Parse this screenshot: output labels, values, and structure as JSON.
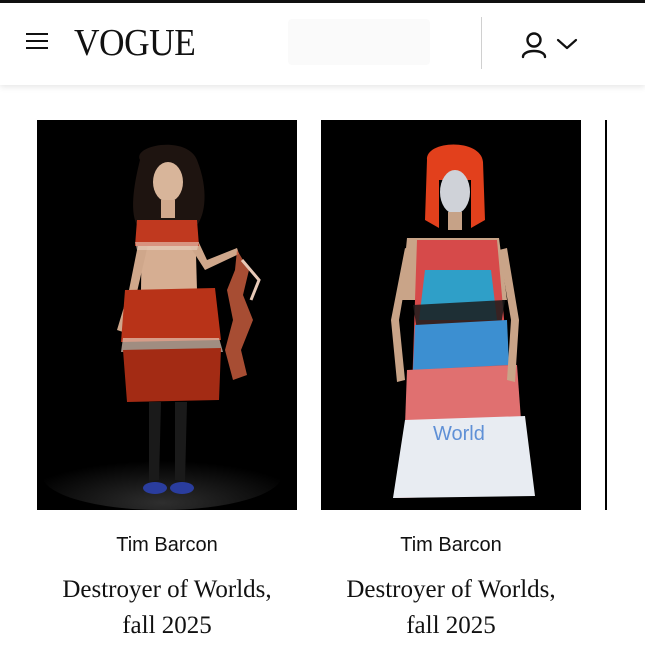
{
  "header": {
    "brand": "VOGUE",
    "menu_icon": "hamburger-menu-icon",
    "account_icon": "user-icon",
    "dropdown_icon": "chevron-down-icon"
  },
  "cards": [
    {
      "designer": "Tim Barcon",
      "title_line1": "Destroyer of Worlds,",
      "title_line2": "fall 2025"
    },
    {
      "designer": "Tim Barcon",
      "title_line1": "Destroyer of Worlds,",
      "title_line2": "fall 2025"
    }
  ],
  "colors": {
    "text": "#111111",
    "background": "#ffffff",
    "image_background": "#000000"
  }
}
